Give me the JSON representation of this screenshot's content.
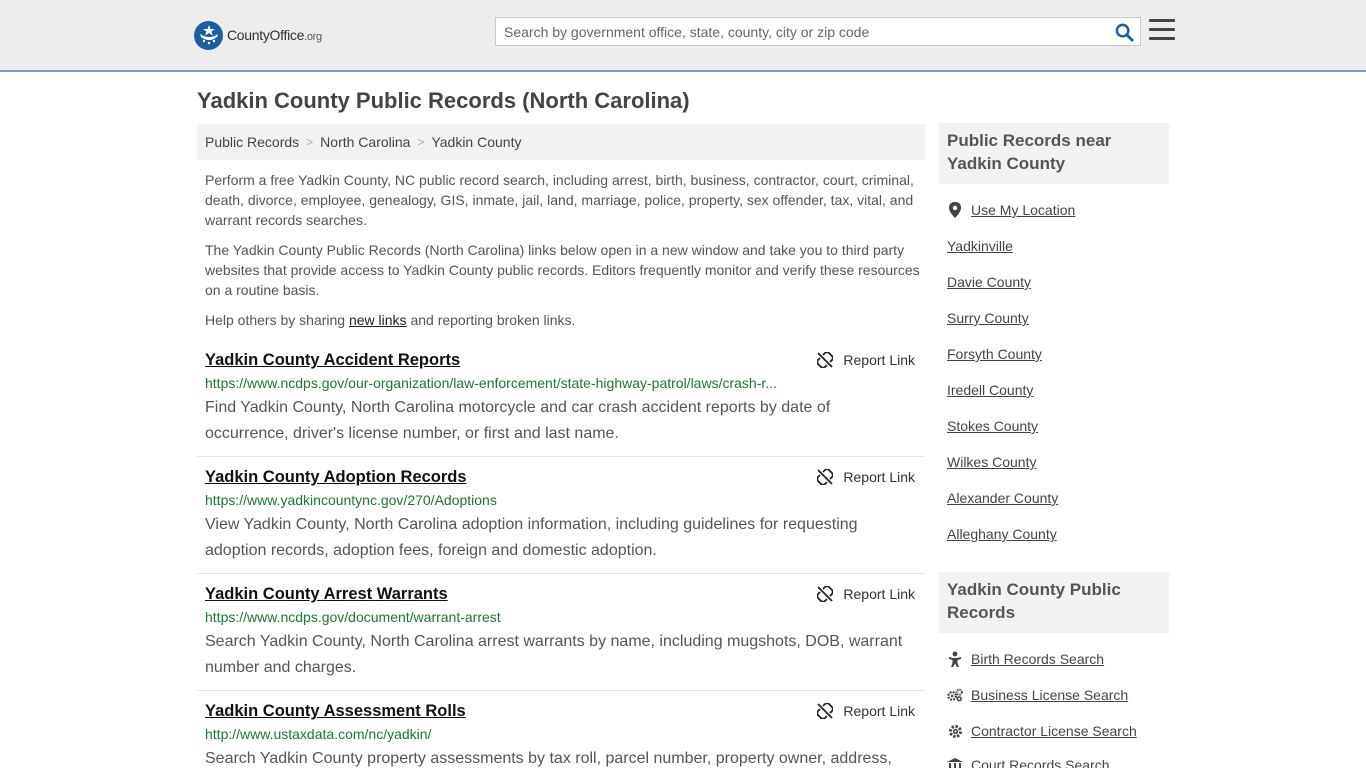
{
  "header": {
    "logo_main": "CountyOffice",
    "logo_tld": ".org",
    "search_placeholder": "Search by government office, state, county, city or zip code"
  },
  "page": {
    "title": "Yadkin County Public Records (North Carolina)"
  },
  "breadcrumb": [
    "Public Records",
    "North Carolina",
    "Yadkin County"
  ],
  "intro": {
    "p1": "Perform a free Yadkin County, NC public record search, including arrest, birth, business, contractor, court, criminal, death, divorce, employee, genealogy, GIS, inmate, jail, land, marriage, police, property, sex offender, tax, vital, and warrant records searches.",
    "p2": "The Yadkin County Public Records (North Carolina) links below open in a new window and take you to third party websites that provide access to Yadkin County public records. Editors frequently monitor and verify these resources on a routine basis.",
    "p3_before": "Help others by sharing ",
    "p3_link": "new links",
    "p3_after": " and reporting broken links."
  },
  "report_label": "Report Link",
  "records": [
    {
      "title": "Yadkin County Accident Reports",
      "url": "https://www.ncdps.gov/our-organization/law-enforcement/state-highway-patrol/laws/crash-r...",
      "desc": "Find Yadkin County, North Carolina motorcycle and car crash accident reports by date of occurrence, driver's license number, or first and last name."
    },
    {
      "title": "Yadkin County Adoption Records",
      "url": "https://www.yadkincountync.gov/270/Adoptions",
      "desc": "View Yadkin County, North Carolina adoption information, including guidelines for requesting adoption records, adoption fees, foreign and domestic adoption."
    },
    {
      "title": "Yadkin County Arrest Warrants",
      "url": "https://www.ncdps.gov/document/warrant-arrest",
      "desc": "Search Yadkin County, North Carolina arrest warrants by name, including mugshots, DOB, warrant number and charges."
    },
    {
      "title": "Yadkin County Assessment Rolls",
      "url": "http://www.ustaxdata.com/nc/yadkin/",
      "desc": "Search Yadkin County property assessments by tax roll, parcel number, property owner, address,"
    }
  ],
  "sidebar": {
    "nearby_heading": "Public Records near Yadkin County",
    "use_location": "Use My Location",
    "nearby": [
      "Yadkinville",
      "Davie County",
      "Surry County",
      "Forsyth County",
      "Iredell County",
      "Stokes County",
      "Wilkes County",
      "Alexander County",
      "Alleghany County"
    ],
    "records_heading": "Yadkin County Public Records",
    "record_links": [
      "Birth Records Search",
      "Business License Search",
      "Contractor License Search",
      "Court Records Search"
    ]
  },
  "colors": {
    "header_bg": "#ededed",
    "header_border": "#6f9ec8",
    "logo_blue": "#1d5f9e",
    "url_green": "#1a7a2e",
    "panel_bg": "#f2f2f2"
  }
}
